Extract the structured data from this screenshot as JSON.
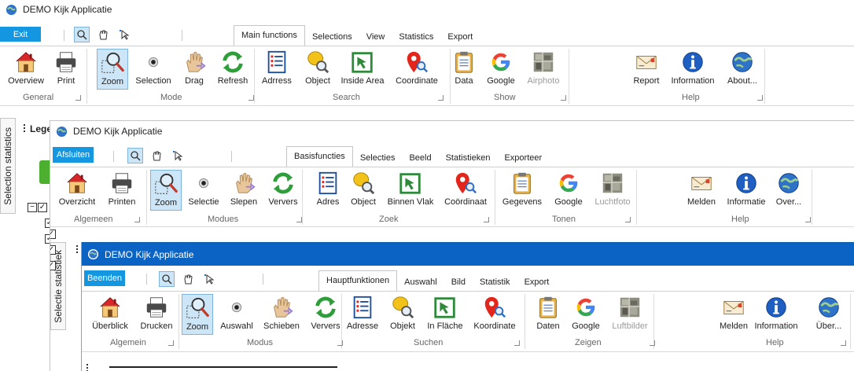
{
  "colors": {
    "exit_bg": "#1497e0",
    "titlebar_active": "#0b64c3",
    "selected_bg": "#cde6f7"
  },
  "w1": {
    "title": "DEMO Kijk Applicatie",
    "exit": "Exit",
    "tabs": [
      "Main functions",
      "Selections",
      "View",
      "Statistics",
      "Export"
    ],
    "buttons": [
      "Overview",
      "Print",
      "Zoom",
      "Selection",
      "Drag",
      "Refresh",
      "Adrress",
      "Object",
      "Inside Area",
      "Coordinate",
      "Data",
      "Google",
      "Airphoto",
      "Report",
      "Information",
      "About..."
    ],
    "groups": [
      "General",
      "Mode",
      "Search",
      "Show",
      "Help"
    ],
    "side_tab": "Selection statistics",
    "legend": "Lege"
  },
  "w2": {
    "title": "DEMO Kijk Applicatie",
    "exit": "Afsluiten",
    "tabs": [
      "Basisfuncties",
      "Selecties",
      "Beeld",
      "Statistieken",
      "Exporteer"
    ],
    "buttons": [
      "Overzicht",
      "Printen",
      "Zoom",
      "Selectie",
      "Slepen",
      "Ververs",
      "Adres",
      "Object",
      "Binnen Vlak",
      "Coördinaat",
      "Gegevens",
      "Google",
      "Luchtfoto",
      "Melden",
      "Informatie",
      "Over..."
    ],
    "groups": [
      "Algemeen",
      "Modues",
      "Zoek",
      "Tonen",
      "Help"
    ],
    "side_tab": "Selectie statistiek"
  },
  "w3": {
    "title": "DEMO Kijk Applicatie",
    "exit": "Beenden",
    "tabs": [
      "Hauptfunktionen",
      "Auswahl",
      "Bild",
      "Statistik",
      "Export"
    ],
    "buttons": [
      "Überblick",
      "Drucken",
      "Zoom",
      "Auswahl",
      "Schieben",
      "Ververs",
      "Adresse",
      "Objekt",
      "In Fläche",
      "Koordinate",
      "Daten",
      "Google",
      "Luftbilder",
      "Melden",
      "Information",
      "Über..."
    ],
    "groups": [
      "Algemein",
      "Modus",
      "Suchen",
      "Zeigen",
      "Help"
    ]
  }
}
